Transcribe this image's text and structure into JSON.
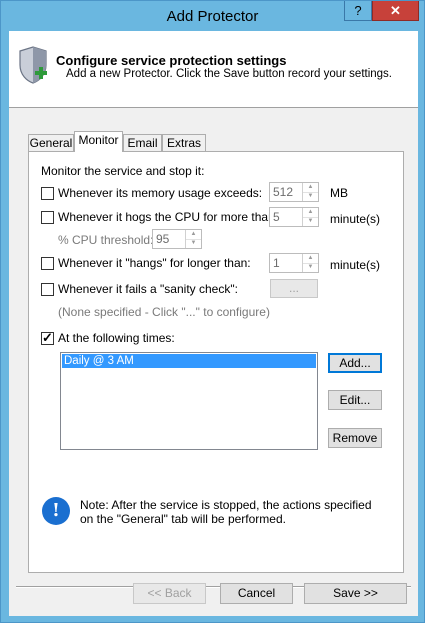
{
  "window": {
    "title": "Add Protector",
    "help_label": "?",
    "close_label": "✕"
  },
  "header": {
    "title": "Configure service protection settings",
    "subtitle": "Add a new Protector. Click the Save button record your settings."
  },
  "tabs": [
    "General",
    "Monitor",
    "Email",
    "Extras"
  ],
  "monitor": {
    "intro": "Monitor the service and stop it:",
    "memory": {
      "label": "Whenever its memory usage exceeds:",
      "value": "512",
      "unit": "MB",
      "checked": false
    },
    "cpu": {
      "label": "Whenever it hogs the CPU for more than:",
      "value": "5",
      "unit": "minute(s)",
      "checked": false
    },
    "cpu_threshold": {
      "label": "% CPU threshold:",
      "value": "95"
    },
    "hangs": {
      "label": "Whenever it \"hangs\" for longer than:",
      "value": "1",
      "unit": "minute(s)",
      "checked": false
    },
    "sanity": {
      "label": "Whenever it fails a \"sanity check\":",
      "button": "...",
      "hint": "(None specified - Click \"...\" to configure)",
      "checked": false
    },
    "times": {
      "label": "At the following times:",
      "checked": true,
      "items": [
        "Daily @ 3 AM"
      ]
    },
    "buttons": {
      "add": "Add...",
      "edit": "Edit...",
      "remove": "Remove"
    },
    "note_icon": "!",
    "note": "Note: After the service is stopped, the actions specified on the \"General\" tab will be performed."
  },
  "footer": {
    "back": "<< Back",
    "cancel": "Cancel",
    "save": "Save >>"
  }
}
